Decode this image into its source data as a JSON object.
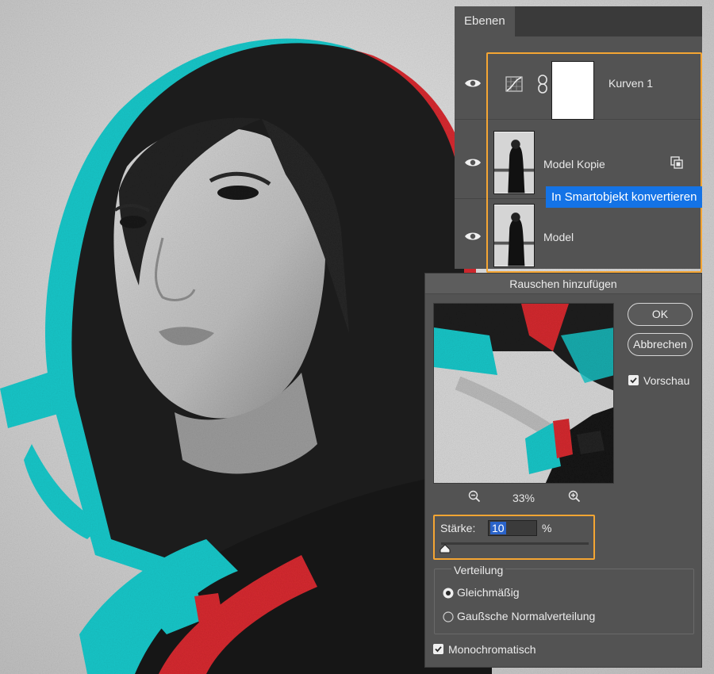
{
  "layers_panel": {
    "tab_label": "Ebenen",
    "layers": [
      {
        "name": "Kurven 1",
        "type": "adjustment-curves",
        "visible": true
      },
      {
        "name": "Model Kopie",
        "type": "smart-object",
        "visible": true
      },
      {
        "name": "Model",
        "type": "image",
        "visible": true
      }
    ]
  },
  "tooltip": {
    "text": "In Smartobjekt konvertieren"
  },
  "dialog": {
    "title": "Rauschen hinzufügen",
    "ok_label": "OK",
    "cancel_label": "Abbrechen",
    "preview_label": "Vorschau",
    "preview_checked": true,
    "zoom": "33%",
    "amount_label": "Stärke:",
    "amount_value": "10",
    "amount_unit": "%",
    "amount_fraction": 0.025,
    "distribution_title": "Verteilung",
    "distribution_options": [
      {
        "label": "Gleichmäßig",
        "selected": true
      },
      {
        "label": "Gaußsche Normalverteilung",
        "selected": false
      }
    ],
    "monochrome_label": "Monochromatisch",
    "monochrome_checked": true
  },
  "colors": {
    "highlight": "#f4a533",
    "tooltip": "#1473e6",
    "panel": "#535353"
  },
  "icons": [
    "eye-icon",
    "curves-icon",
    "link-icon",
    "smart-object-icon",
    "zoom-out-icon",
    "zoom-in-icon",
    "checkbox-icon",
    "radio-icon"
  ]
}
